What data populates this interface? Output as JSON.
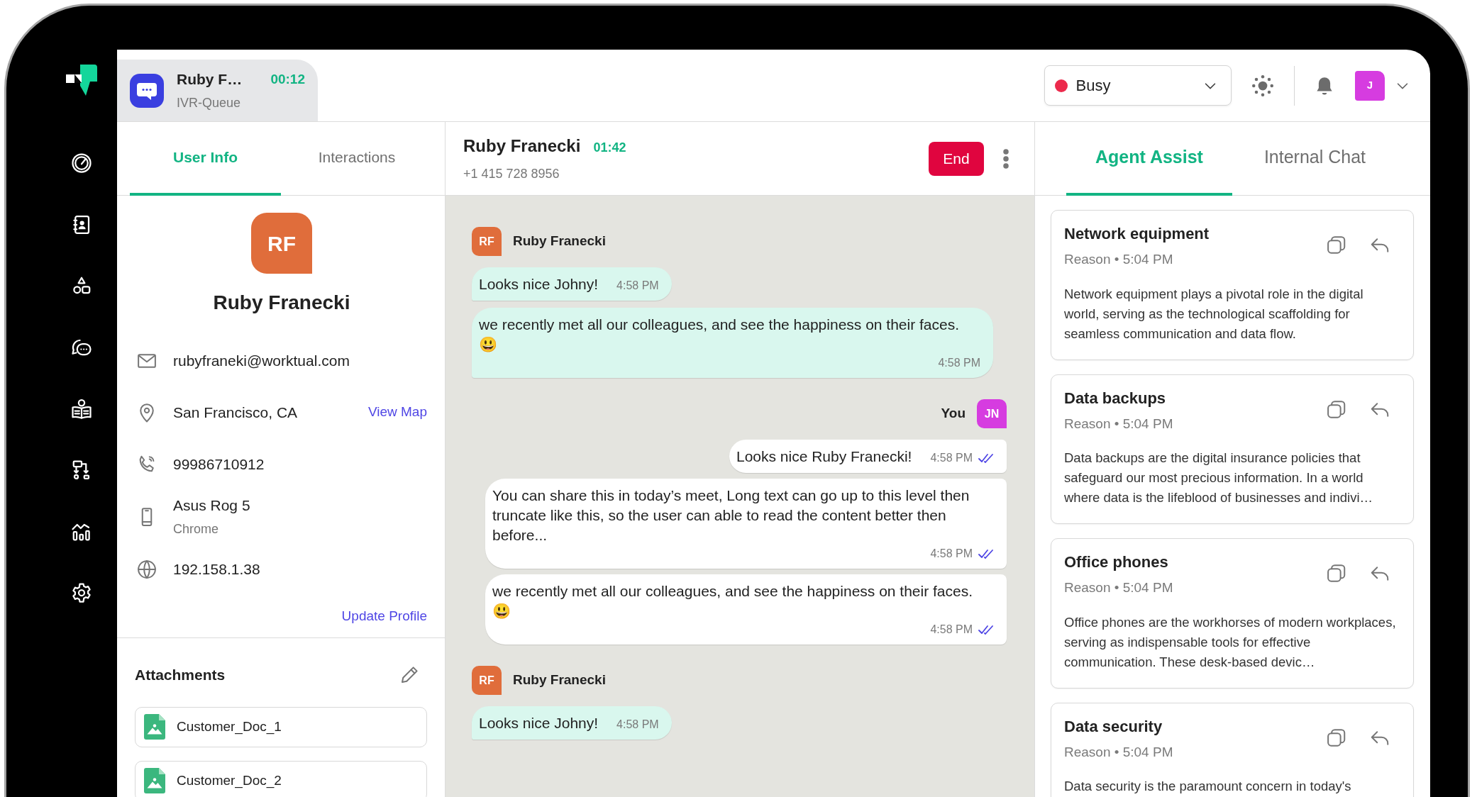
{
  "call_tab": {
    "name": "Ruby F…",
    "timer": "00:12",
    "queue": "IVR-Queue"
  },
  "status": {
    "label": "Busy"
  },
  "account": {
    "initial": "J"
  },
  "left_tabs": [
    {
      "label": "User Info",
      "selected": true
    },
    {
      "label": "Interactions",
      "selected": false
    }
  ],
  "profile": {
    "initials": "RF",
    "name": "Ruby Franecki",
    "details": [
      {
        "kind": "email",
        "value": "rubyfraneki@worktual.com"
      },
      {
        "kind": "location",
        "value": "San Francisco, CA",
        "link": "View Map"
      },
      {
        "kind": "phone",
        "value": "99986710912"
      },
      {
        "kind": "device",
        "value": "Asus Rog 5",
        "sub": "Chrome"
      },
      {
        "kind": "ip",
        "value": "192.158.1.38"
      }
    ],
    "action": "Update Profile"
  },
  "attachments": {
    "title": "Attachments",
    "files": [
      {
        "name": "Customer_Doc_1"
      },
      {
        "name": "Customer_Doc_2"
      }
    ]
  },
  "conversation": {
    "name": "Ruby Franecki",
    "timer": "01:42",
    "phone": "+1 415 728 8956",
    "end": "End"
  },
  "messages": [
    {
      "kind": "incoming_sender",
      "initials": "RF",
      "name": "Ruby Franecki",
      "color": "#e06d3b"
    },
    {
      "kind": "incoming",
      "text": "Looks nice Johny!",
      "time": "4:58 PM"
    },
    {
      "kind": "incoming",
      "text": "we recently met all our colleagues, and see the happiness on their faces. 😃",
      "time": "4:58 PM"
    },
    {
      "kind": "outgoing_sender",
      "initials": "JN",
      "name": "You",
      "color": "#d63ce0"
    },
    {
      "kind": "outgoing",
      "text": "Looks nice Ruby Franecki!",
      "time": "4:58 PM",
      "read": true
    },
    {
      "kind": "outgoing",
      "text": "You can share this in today’s meet, Long text can go up to this level then truncate like this, so the user can able to read the content better then before...",
      "time": "4:58 PM",
      "read": true
    },
    {
      "kind": "outgoing",
      "text": "we recently met all our colleagues, and see the happiness on their faces. 😃",
      "time": "4:58 PM",
      "read": true
    },
    {
      "kind": "incoming_sender",
      "initials": "RF",
      "name": "Ruby Franecki",
      "color": "#e06d3b"
    },
    {
      "kind": "incoming",
      "text": "Looks nice Johny!",
      "time": "4:58 PM"
    }
  ],
  "assist_tabs": [
    {
      "label": "Agent Assist",
      "selected": true
    },
    {
      "label": "Internal Chat",
      "selected": false
    }
  ],
  "assist_cards": [
    {
      "title": "Network equipment",
      "meta": "Reason • 5:04 PM",
      "body": "Network equipment plays a pivotal role in the digital world, serving as the technological scaffolding for seamless communication and data flow."
    },
    {
      "title": "Data backups",
      "meta": "Reason • 5:04 PM",
      "body": "Data backups are the digital insurance policies that safeguard our most precious information. In a world where data is the lifeblood of businesses and indivi…"
    },
    {
      "title": "Office phones",
      "meta": "Reason • 5:04 PM",
      "body": "Office phones are the workhorses of modern workplaces, serving as indispensable tools for effective communication. These desk-based devic…"
    },
    {
      "title": "Data security",
      "meta": "Reason • 5:04 PM",
      "body": "Data security is the paramount concern in today's"
    }
  ]
}
